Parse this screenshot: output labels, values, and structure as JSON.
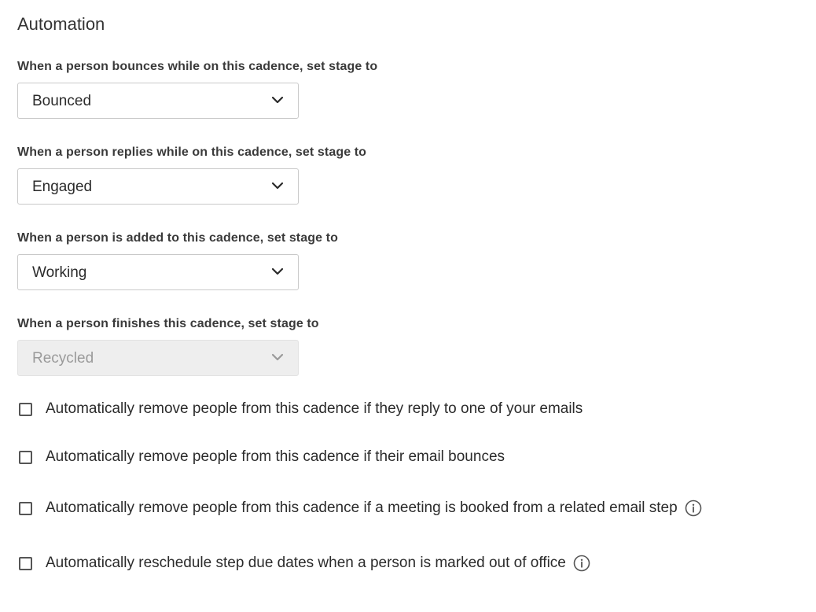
{
  "automation": {
    "title": "Automation",
    "fields": [
      {
        "label": "When a person bounces while on this cadence, set stage to",
        "value": "Bounced",
        "disabled": false
      },
      {
        "label": "When a person replies while on this cadence, set stage to",
        "value": "Engaged",
        "disabled": false
      },
      {
        "label": "When a person is added to this cadence, set stage to",
        "value": "Working",
        "disabled": false
      },
      {
        "label": "When a person finishes this cadence, set stage to",
        "value": "Recycled",
        "disabled": true
      }
    ],
    "checkboxes": [
      {
        "label": "Automatically remove people from this cadence if they reply to one of your emails",
        "checked": false,
        "info_icon": false
      },
      {
        "label": "Automatically remove people from this cadence if their email bounces",
        "checked": false,
        "info_icon": false
      },
      {
        "label": "Automatically remove people from this cadence if a meeting is booked from a related email step",
        "checked": false,
        "info_icon": true
      },
      {
        "label": "Automatically reschedule step due dates when a person is marked out of office",
        "checked": false,
        "info_icon": true
      }
    ]
  },
  "icons": {
    "dropdown": "chevron-down-icon",
    "info": "info-circle-icon"
  },
  "colors": {
    "text": "#2b2b2b",
    "label": "#3a3a3a",
    "border": "#c9c9c9",
    "disabled_bg": "#eeeeee",
    "disabled_text": "#9a9a9a"
  }
}
